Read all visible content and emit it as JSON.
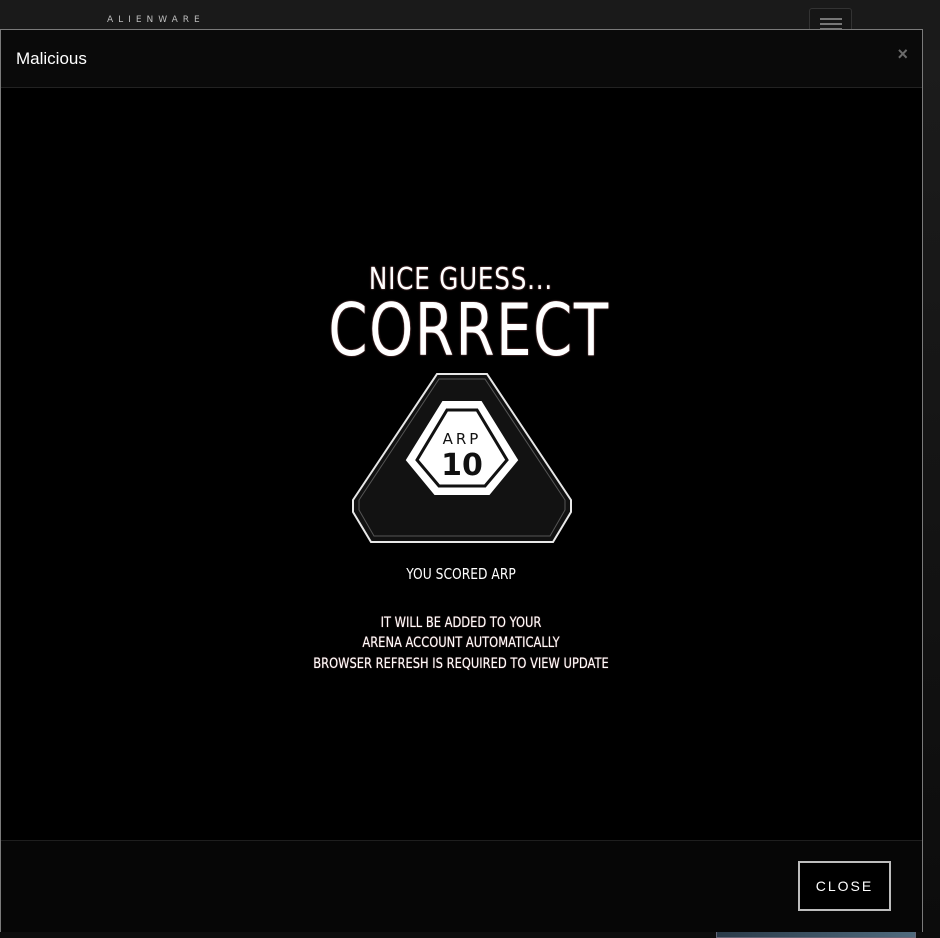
{
  "site": {
    "brand": "ALIENWARE"
  },
  "modal": {
    "title": "Malicious",
    "close_icon_glyph": "×",
    "footer": {
      "close_label": "CLOSE"
    },
    "result": {
      "headline_small": "NICE GUESS...",
      "headline_big": "CORRECT",
      "badge": {
        "unit": "ARP",
        "points": "10",
        "label": "YOU SCORED ARP"
      },
      "info_lines": [
        "IT WILL BE ADDED TO YOUR",
        "ARENA ACCOUNT AUTOMATICALLY",
        "BROWSER REFRESH IS REQUIRED TO VIEW UPDATE"
      ]
    }
  },
  "colors": {
    "page_bg": "#0d0d0d",
    "modal_bg": "#000000",
    "text": "#ffffff",
    "border": "#bdbdbd"
  }
}
